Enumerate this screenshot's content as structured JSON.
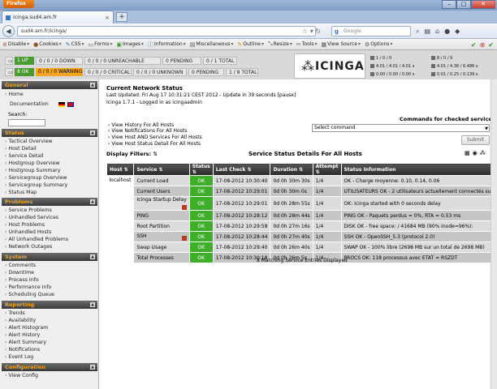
{
  "browser": {
    "app_button": "Firefox",
    "tab_title": "icinga.sud4.am.fr",
    "url": "sud4.am.fr/icinga/",
    "search_placeholder": "Google",
    "webdev_items": [
      "Disable",
      "Cookies",
      "CSS",
      "Forms",
      "Images",
      "Information",
      "Miscellaneous",
      "Outline",
      "Resize",
      "Tools",
      "View Source",
      "Options"
    ]
  },
  "status_bar": {
    "hosts": {
      "up": "1 UP",
      "down": "0 / 0 / 0 DOWN",
      "unreachable": "0 / 0 / 0 UNREACHABLE",
      "pending": "0 PENDING",
      "total": "0 / 1 TOTAL"
    },
    "services": {
      "ok": "8 OK",
      "warning": "0 / 0 / 0 WARNING",
      "critical": "0 / 0 / 0 CRITICAL",
      "unknown": "0 / 0 / 0 UNKNOWN",
      "pending": "0 PENDING",
      "total": "1 / 8 TOTAL"
    },
    "perf_left": [
      "1 / 0 / 0",
      "4.01 / 4.01 / 4.01 s",
      "0.00 / 0.00 / 0.00 s"
    ],
    "perf_right": [
      "8 / 0 / 0",
      "4.01 / 4.36 / 6.486 s",
      "0.01 / 0.25 / 0.139 s"
    ]
  },
  "logo": {
    "text": "ICINGA"
  },
  "sidebar": {
    "general": {
      "title": "General",
      "items": [
        "Home",
        "Documentation"
      ],
      "search_label": "Search:"
    },
    "status": {
      "title": "Status",
      "items": [
        "Tactical Overview",
        "Host Detail",
        "Service Detail",
        "Hostgroup Overview",
        "Hostgroup Summary",
        "Servicegroup Overview",
        "Servicegroup Summary",
        "Status Map"
      ]
    },
    "problems": {
      "title": "Problems",
      "items": [
        "Service Problems",
        "Unhandled Services",
        "Host Problems",
        "Unhandled Hosts",
        "All Unhandled Problems",
        "Network Outages"
      ]
    },
    "system": {
      "title": "System",
      "items": [
        "Comments",
        "Downtime",
        "Process Info",
        "Performance Info",
        "Scheduling Queue"
      ]
    },
    "reporting": {
      "title": "Reporting",
      "items": [
        "Trends",
        "Availability",
        "Alert Histogram",
        "Alert History",
        "Alert Summary",
        "Notifications",
        "Event Log"
      ]
    },
    "configuration": {
      "title": "Configuration",
      "items": [
        "View Config"
      ]
    }
  },
  "main": {
    "heading": "Current Network Status",
    "updated": "Last Updated: Fri Aug 17 10:31:21 CEST 2012 - Update in 39 seconds [pause]",
    "version": "Icinga 1.7.1 - Logged in as icingaadmin",
    "links": [
      "View History For All Hosts",
      "View Notifications For All Hosts",
      "View Host AND Services For All Hosts",
      "View Host Status Detail For All Hosts"
    ],
    "commands_title": "Commands for checked services",
    "command_select": "Select command",
    "submit": "Submit",
    "display_filters": "Display Filters:",
    "table_title": "Service Status Details For All Hosts",
    "columns": [
      "Host",
      "Service",
      "Status",
      "Last Check",
      "Duration",
      "Attempt",
      "Status Information"
    ],
    "host": "localhost",
    "rows": [
      {
        "service": "Current Load",
        "status": "OK",
        "last_check": "17-08-2012 10:30:40",
        "duration": "0d 0h 30m 30s",
        "attempt": "1/4",
        "info": "OK - Charge moyenne: 0.10, 0.14, 0.06"
      },
      {
        "service": "Current Users",
        "status": "OK",
        "last_check": "17-08-2012 10:29:01",
        "duration": "0d 0h 30m 0s",
        "attempt": "1/4",
        "info": "UTILISATEURS OK - 2 utilisateurs actuellement connectés sur"
      },
      {
        "service": "Icinga Startup Delay",
        "status": "OK",
        "last_check": "17-08-2012 10:29:01",
        "duration": "0d 0h 28m 55s",
        "attempt": "1/4",
        "info": "OK: Icinga started with 0 seconds delay"
      },
      {
        "service": "PING",
        "status": "OK",
        "last_check": "17-08-2012 10:28:12",
        "duration": "0d 0h 28m 44s",
        "attempt": "1/4",
        "info": "PING OK - Paquets perdus = 0%, RTA = 0.53 ms"
      },
      {
        "service": "Root Partition",
        "status": "OK",
        "last_check": "17-08-2012 10:29:58",
        "duration": "0d 0h 27m 16s",
        "attempt": "1/4",
        "info": "DISK OK - free space: / 41684 MB (90% inode=96%):"
      },
      {
        "service": "SSH",
        "status": "OK",
        "last_check": "17-08-2012 10:28:44",
        "duration": "0d 0h 27m 40s",
        "attempt": "1/4",
        "info": "SSH OK - OpenSSH_5.3 (protocol 2.0)"
      },
      {
        "service": "Swap Usage",
        "status": "OK",
        "last_check": "17-08-2012 10:29:40",
        "duration": "0d 0h 26m 40s",
        "attempt": "1/4",
        "info": "SWAP OK - 100% libre (2698 MB sur un total de 2698 MB)"
      },
      {
        "service": "Total Processes",
        "status": "OK",
        "last_check": "17-08-2012 10:30:18",
        "duration": "0d 0h 26m 5s",
        "attempt": "1/4",
        "info": "PROCS OK: 118 processus avec ETAT = RSZDT"
      }
    ],
    "footer": "8 Matching Service Entries Displayed"
  }
}
